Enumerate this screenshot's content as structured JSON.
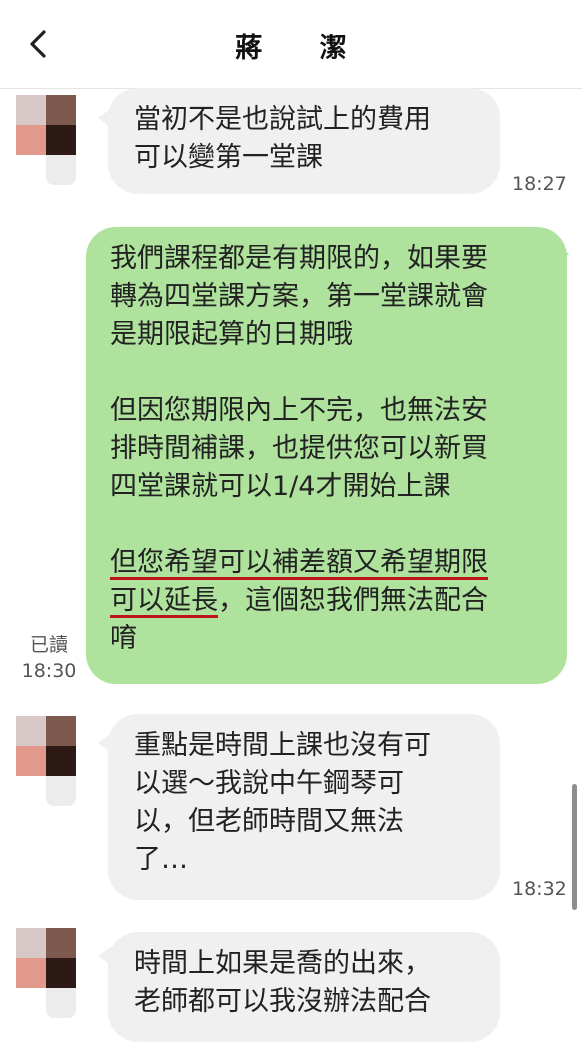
{
  "header": {
    "title": "蔣 潔",
    "back_icon": "chevron-left-icon"
  },
  "messages": [
    {
      "side": "incoming",
      "lines": [
        "當初不是也說試上的費用",
        "可以變第一堂課"
      ],
      "time": "18:27"
    },
    {
      "side": "outgoing",
      "paragraph1": [
        "我們課程都是有期限的，如果要",
        "轉為四堂課方案，第一堂課就會",
        "是期限起算的日期哦"
      ],
      "paragraph2": [
        "但因您期限內上不完，也無法安",
        "排時間補課，也提供您可以新買",
        "四堂課就可以1/4才開始上課"
      ],
      "paragraph3": {
        "line1_underlined": "但您希望可以補差額又希望期限",
        "line2_underlined": "可以延長",
        "line2_rest": "，這個恕我們無法配合",
        "line3": "唷"
      },
      "read_label": "已讀",
      "time": "18:30"
    },
    {
      "side": "incoming",
      "lines": [
        "重點是時間上課也沒有可",
        "以選～我說中午鋼琴可",
        "以，但老師時間又無法",
        "了…"
      ],
      "time": "18:32"
    },
    {
      "side": "incoming",
      "lines": [
        "時間上如果是喬的出來，",
        "老師都可以我沒辦法配合"
      ],
      "time": ""
    }
  ],
  "colors": {
    "outgoing_bubble": "#aee29d",
    "incoming_bubble": "#f0f0f1",
    "underline": "#c0141d"
  }
}
